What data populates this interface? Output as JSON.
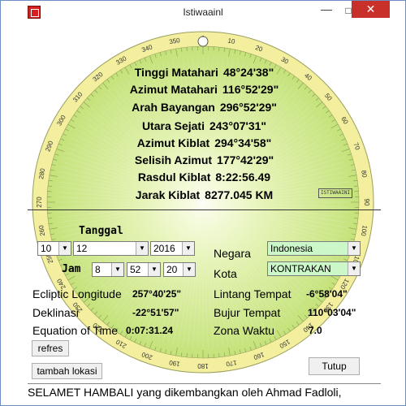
{
  "window": {
    "title": "Istiwaainl",
    "minimize": "—",
    "maximize": "□",
    "close": "✕"
  },
  "compass": {
    "north_marker": "0",
    "degree_labels": [
      "0",
      "10",
      "20",
      "30",
      "40",
      "50",
      "60",
      "70",
      "80",
      "90",
      "100",
      "110",
      "120",
      "130",
      "140",
      "150",
      "160",
      "170",
      "180",
      "190",
      "200",
      "210",
      "220",
      "230",
      "240",
      "250",
      "260",
      "270",
      "280",
      "290",
      "300",
      "310",
      "320",
      "330",
      "340",
      "350"
    ],
    "logo_text": "ISTIWAAINI"
  },
  "sun_info": [
    {
      "label": "Tinggi Matahari",
      "value": "48°24'38\""
    },
    {
      "label": "Azimut Matahari",
      "value": "116°52'29\""
    },
    {
      "label": "Arah Bayangan",
      "value": "296°52'29\""
    },
    {
      "label": "Utara Sejati",
      "value": "243°07'31\""
    },
    {
      "label": "Azimut Kiblat",
      "value": "294°34'58\""
    },
    {
      "label": "Selisih Azimut",
      "value": "177°42'29\""
    },
    {
      "label": "Rasdul Kiblat",
      "value": "8:22:56.49"
    },
    {
      "label": "Jarak Kiblat",
      "value": "8277.045 KM"
    }
  ],
  "date": {
    "label": "Tanggal",
    "day": "10",
    "month": "12",
    "year": "2016"
  },
  "time": {
    "label": "Jam",
    "hour": "8",
    "minute": "52",
    "second": "20"
  },
  "location": {
    "country_label": "Negara",
    "country": "Indonesia",
    "city_label": "Kota",
    "city": "KONTRAKAN"
  },
  "astro": {
    "ecliptic_label": "Ecliptic Longitude",
    "ecliptic_value": "257°40'25\"",
    "declination_label": "Deklinasi",
    "declination_value": "-22°51'57\"",
    "eot_label": "Equation of Time",
    "eot_value": "0:07:31.24",
    "latitude_label": "Lintang Tempat",
    "latitude_value": "-6°58'04\"",
    "longitude_label": "Bujur Tempat",
    "longitude_value": "110°03'04\"",
    "zone_label": "Zona Waktu",
    "zone_value": "7.0"
  },
  "buttons": {
    "refresh": "refres",
    "add_location": "tambah lokasi",
    "close": "Tutup"
  },
  "status_text": "SELAMET HAMBALI yang dikembangkan oleh Ahmad Fadloli,",
  "colors": {
    "dial_inner": "#cde98a",
    "dial_ring": "#f3ef9e",
    "close_red": "#c7312a",
    "combo_green": "#ccf7c8"
  }
}
